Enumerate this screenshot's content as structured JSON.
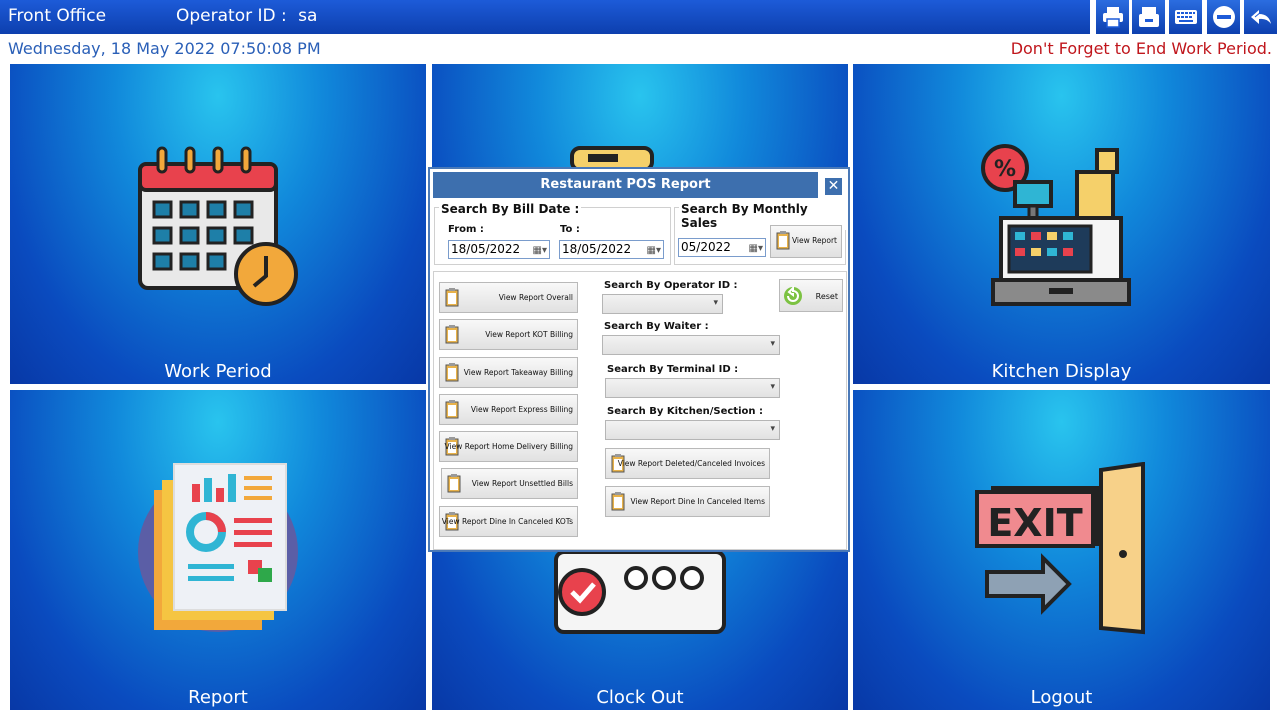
{
  "header": {
    "title": "Front Office",
    "operator_label": "Operator ID :",
    "operator_value": "sa"
  },
  "toolbar": {
    "icons": [
      "printer-icon",
      "cash-drawer-icon",
      "keyboard-icon",
      "minimize-icon",
      "back-icon"
    ]
  },
  "info": {
    "datetime": "Wednesday, 18 May 2022 07:50:08 PM",
    "reminder": "Don't Forget to End Work Period."
  },
  "tiles": [
    {
      "label": "Work Period",
      "icon": "calendar-clock-icon"
    },
    {
      "label": "",
      "icon": "receipt-icon"
    },
    {
      "label": "Kitchen Display",
      "icon": "cash-register-icon"
    },
    {
      "label": "Report",
      "icon": "report-icon"
    },
    {
      "label": "Clock Out",
      "icon": "clock-out-icon"
    },
    {
      "label": "Logout",
      "icon": "exit-door-icon"
    }
  ],
  "dialog": {
    "title": "Restaurant POS Report",
    "close_label": "✕",
    "bill_date": {
      "group_label": "Search By Bill Date :",
      "from_label": "From :",
      "from_value": "18/05/2022",
      "to_label": "To :",
      "to_value": "18/05/2022"
    },
    "monthly": {
      "group_label": "Search By Monthly Sales",
      "month_value": "05/2022",
      "button_label": "View Report"
    },
    "report_buttons": [
      "View Report Overall",
      "View Report KOT Billing",
      "View Report Takeaway Billing",
      "View Report Express Billing",
      "View Report Home Delivery Billing",
      "View Report Unsettled Bills",
      "View Report Dine In Canceled KOTs"
    ],
    "filters": {
      "operator_label": "Search By Operator ID :",
      "waiter_label": "Search By Waiter :",
      "terminal_label": "Search By Terminal ID :",
      "kitchen_label": "Search By Kitchen/Section :"
    },
    "reset_label": "Reset",
    "right_buttons": [
      "View Report Deleted/Canceled Invoices",
      "View Report Dine In Canceled Items"
    ]
  },
  "colors": {
    "header_bg": "#1d5bd8",
    "reminder": "#c0161c",
    "datetime": "#2a5fb7",
    "tile_bg": "#0a4bbf"
  }
}
